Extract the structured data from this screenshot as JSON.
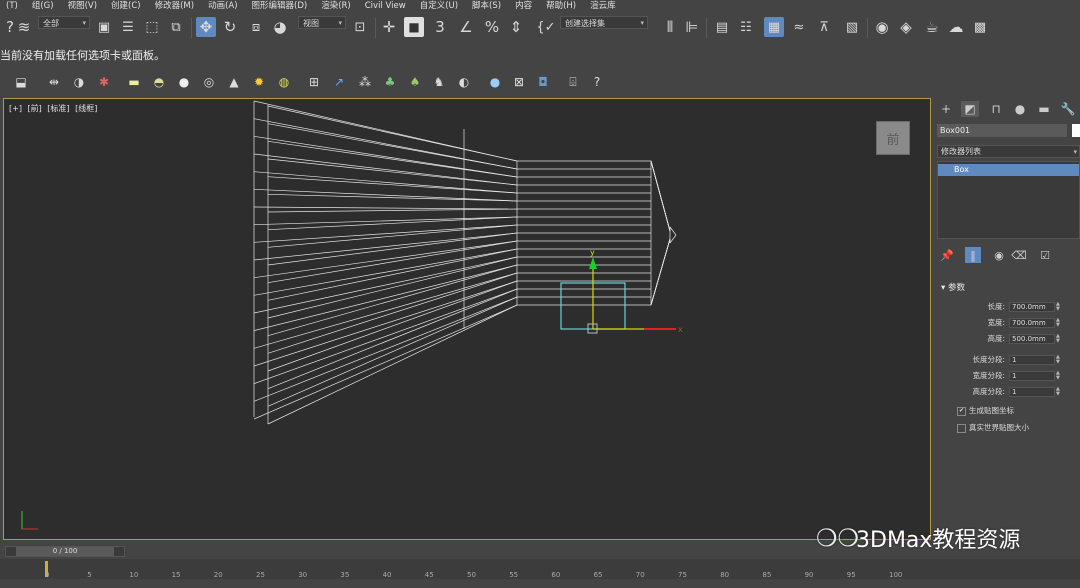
{
  "menu": [
    "(T)",
    "组(G)",
    "视图(V)",
    "创建(C)",
    "修改器(M)",
    "动画(A)",
    "图形编辑器(D)",
    "渲染(R)",
    "Civil View",
    "自定义(U)",
    "脚本(S)",
    "内容",
    "帮助(H)",
    "渲云库"
  ],
  "toolbar": {
    "selection_filter": "全部",
    "ref_coord": "视图",
    "named_selection": "创建选择集",
    "snap_label": "3",
    "icons": [
      "undo-icon",
      "bind-icon",
      "select-object-icon",
      "select-by-name-icon",
      "rect-select-icon",
      "window-crossing-icon",
      "move-icon",
      "rotate-icon",
      "scale-icon",
      "place-icon",
      "pivot-icon",
      "link-icon",
      "snap-icon",
      "angle-snap-icon",
      "percent-snap-icon",
      "spinner-snap-icon",
      "edit-named-icon",
      "mirror-icon",
      "align-icon",
      "layer-explorer-icon",
      "scene-explorer-icon",
      "ribbon-icon",
      "curve-editor-icon",
      "dope-sheet-icon",
      "schematic-icon",
      "material-editor-icon",
      "render-setup-icon",
      "render-frame-icon",
      "render-icon",
      "render-online-icon",
      "extra-icon"
    ]
  },
  "notice": "当前没有加载任何选项卡或面板。",
  "viewport": {
    "labels": [
      "[+]",
      "[前]",
      "[标准]",
      "[线框]"
    ],
    "viewcube_label": "前",
    "axis_y": "y",
    "axis_x": "x"
  },
  "command_panel": {
    "object_name": "Box001",
    "object_color": "#ffffff",
    "modifier_list": "修改器列表",
    "stack_item": "Box",
    "rollout_title": "参数",
    "params": [
      {
        "label": "长度:",
        "value": "700.0mm"
      },
      {
        "label": "宽度:",
        "value": "700.0mm"
      },
      {
        "label": "高度:",
        "value": "500.0mm"
      }
    ],
    "segments": [
      {
        "label": "长度分段:",
        "value": "1"
      },
      {
        "label": "宽度分段:",
        "value": "1"
      },
      {
        "label": "高度分段:",
        "value": "1"
      }
    ],
    "gen_mapping": "生成贴图坐标",
    "gen_mapping_checked": "✔",
    "real_world": "真实世界贴图大小"
  },
  "timeslider": {
    "label": "0 / 100"
  },
  "trackbar_ticks": [
    "0",
    "5",
    "10",
    "15",
    "20",
    "25",
    "30",
    "35",
    "40",
    "45",
    "50",
    "55",
    "60",
    "65",
    "70",
    "75",
    "80",
    "85",
    "90",
    "95",
    "100"
  ],
  "watermark": "3DMax教程资源"
}
